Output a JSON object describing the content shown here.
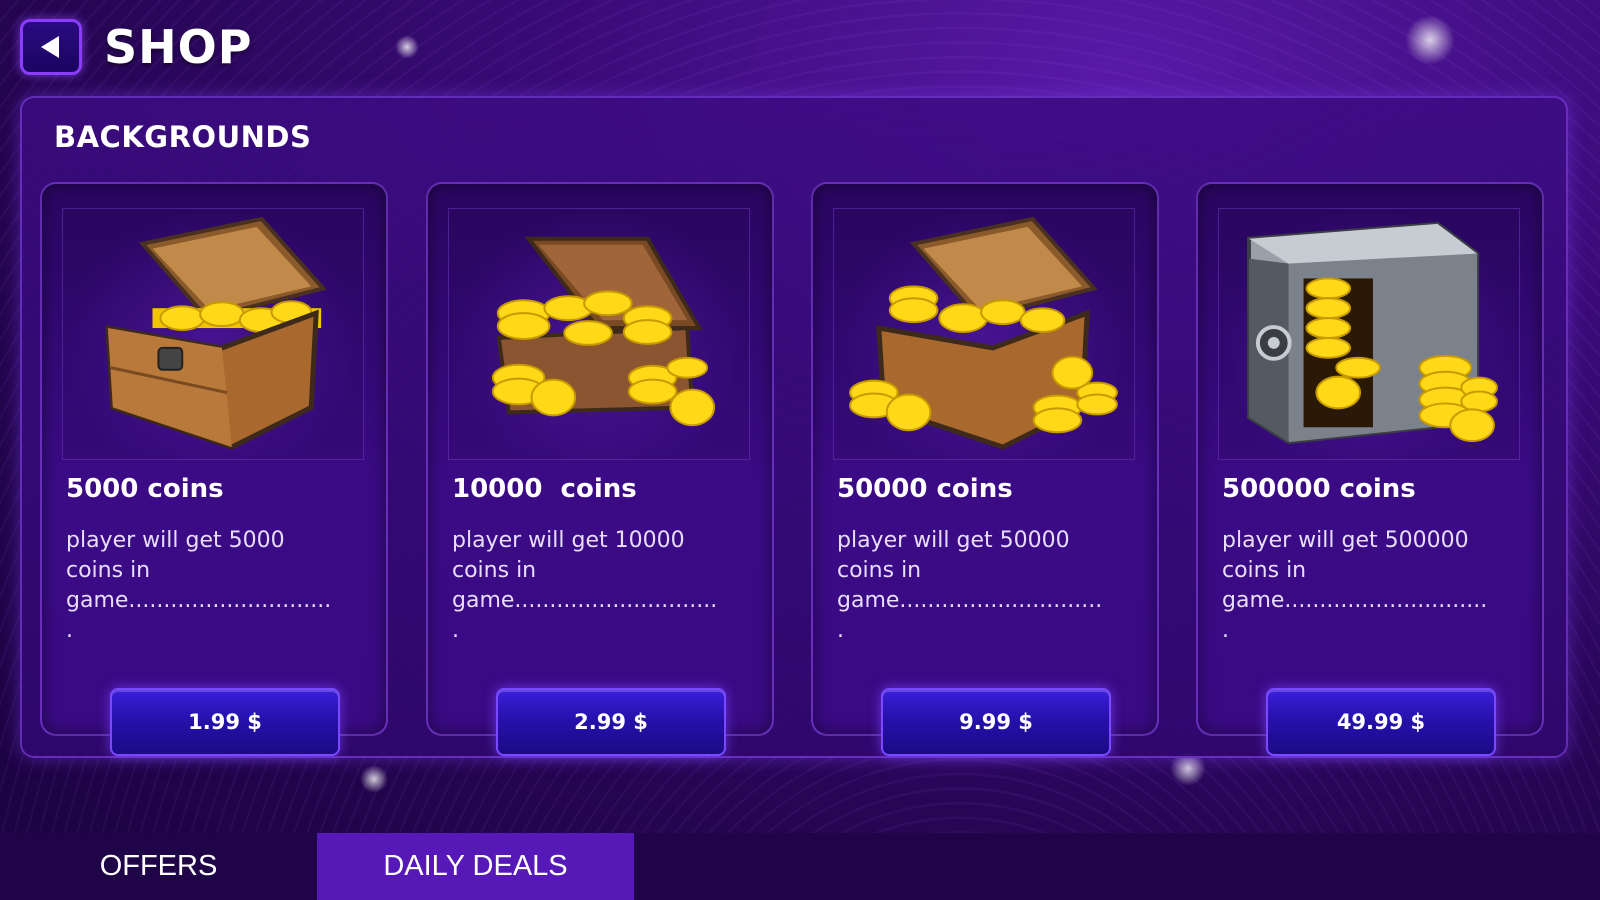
{
  "header": {
    "title": "SHOP"
  },
  "section": {
    "title": "BACKGROUNDS"
  },
  "products": [
    {
      "title": "5000 coins",
      "description": "player will get 5000 coins in game..............................",
      "price": "1.99 $",
      "icon": "treasure-chest-icon"
    },
    {
      "title": "10000  coins",
      "description": "player will get 10000 coins in game..............................",
      "price": "2.99 $",
      "icon": "open-chest-coins-icon"
    },
    {
      "title": "50000 coins",
      "description": "player will get 50000 coins in game..............................",
      "price": "9.99 $",
      "icon": "chest-coin-stacks-icon"
    },
    {
      "title": "500000 coins",
      "description": "player will get 500000 coins in game..............................",
      "price": "49.99 $",
      "icon": "safe-coins-icon"
    }
  ],
  "tabs": [
    {
      "label": "OFFERS",
      "active": false
    },
    {
      "label": "DAILY DEALS",
      "active": true
    }
  ],
  "colors": {
    "accent": "#7a48ff",
    "coin": "#f5d000",
    "active_tab": "#5718b8"
  }
}
